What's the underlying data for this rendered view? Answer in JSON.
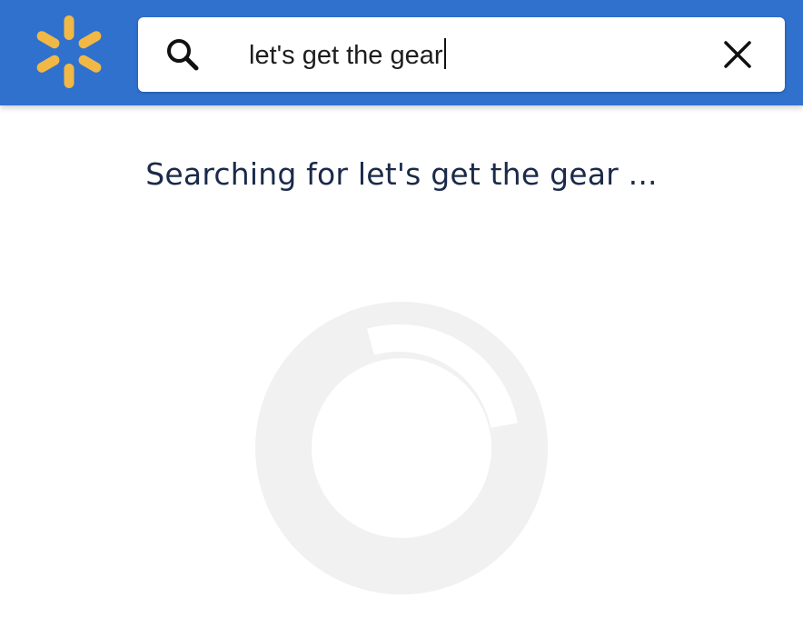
{
  "header": {
    "logo_icon": "walmart-spark-icon",
    "brand_color": "#3071ce",
    "logo_color": "#f2b845"
  },
  "search": {
    "icon": "search-icon",
    "value": "let's get the gear",
    "clear_icon": "close-icon"
  },
  "status": {
    "message": "Searching for let's get the gear ..."
  },
  "loader": {
    "icon": "loading-spinner-icon"
  }
}
